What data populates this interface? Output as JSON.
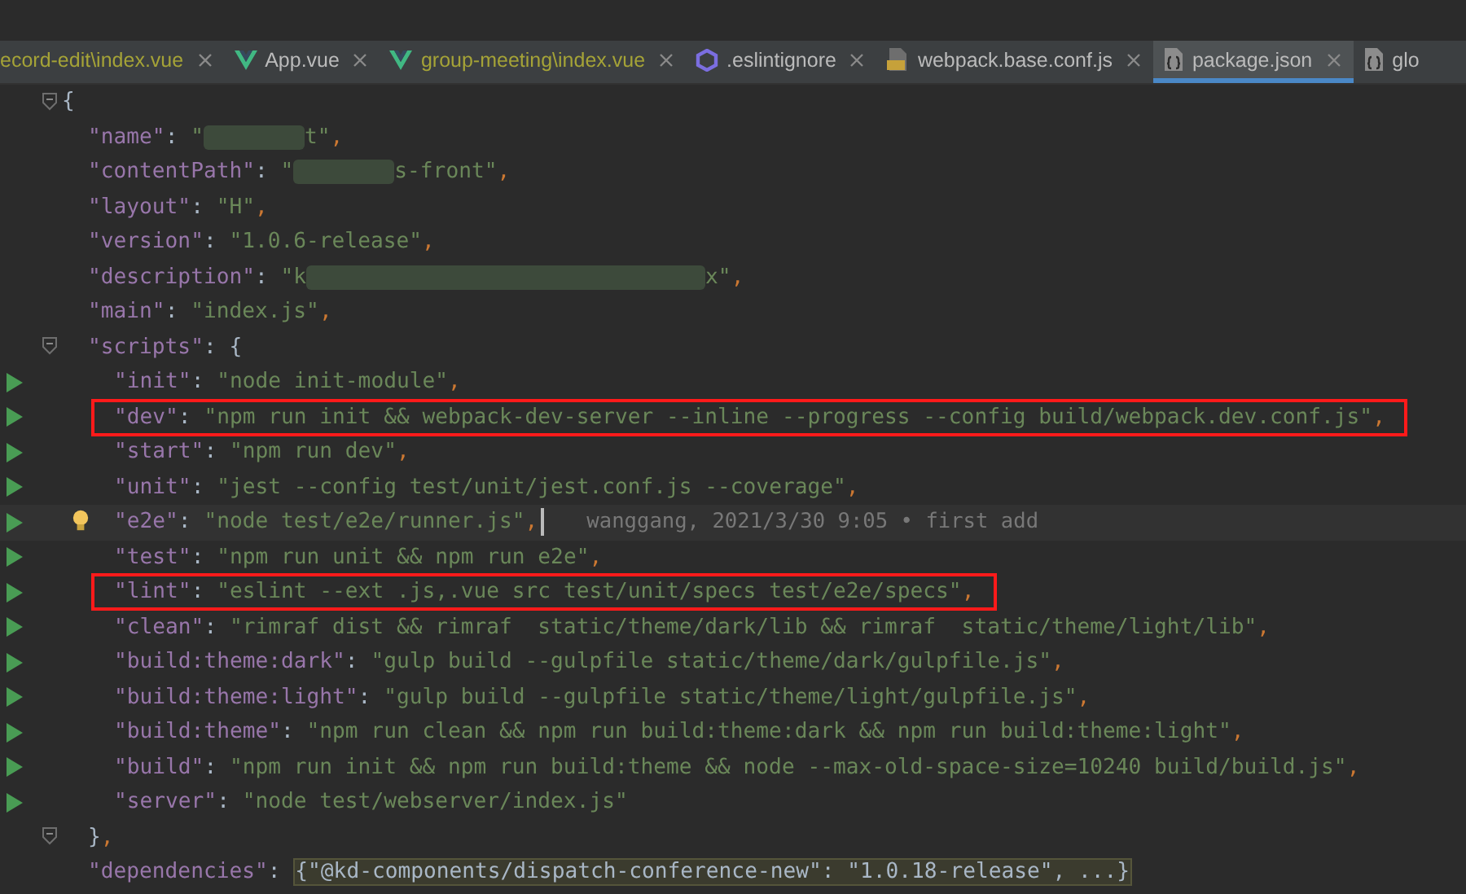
{
  "tabs": [
    {
      "label": "ecord-edit\\index.vue",
      "kind": "plain",
      "modified": true,
      "selected": false
    },
    {
      "label": "App.vue",
      "kind": "vue",
      "modified": false,
      "selected": false
    },
    {
      "label": "group-meeting\\index.vue",
      "kind": "vue",
      "modified": true,
      "selected": false
    },
    {
      "label": ".eslintignore",
      "kind": "eslint",
      "modified": false,
      "selected": false
    },
    {
      "label": "webpack.base.conf.js",
      "kind": "js",
      "modified": false,
      "selected": false
    },
    {
      "label": "package.json",
      "kind": "json",
      "modified": false,
      "selected": true
    },
    {
      "label": "glo",
      "kind": "json",
      "modified": false,
      "selected": false
    }
  ],
  "lines": [
    {
      "fold": true,
      "tokens": [
        {
          "kind": "punct",
          "s": "{"
        }
      ],
      "children": [
        {
          "tokens": [
            {
              "kind": "key",
              "s": "\"name\""
            },
            {
              "kind": "punct",
              "s": ": "
            },
            {
              "kind": "str",
              "s": "\""
            },
            {
              "kind": "redacted"
            },
            {
              "kind": "str",
              "s": "t\""
            },
            {
              "kind": "comma",
              "s": ","
            }
          ]
        },
        {
          "tokens": [
            {
              "kind": "key",
              "s": "\"contentPath\""
            },
            {
              "kind": "punct",
              "s": ": "
            },
            {
              "kind": "str",
              "s": "\""
            },
            {
              "kind": "redacted"
            },
            {
              "kind": "str",
              "s": "s-front\""
            },
            {
              "kind": "comma",
              "s": ","
            }
          ]
        },
        {
          "tokens": [
            {
              "kind": "key",
              "s": "\"layout\""
            },
            {
              "kind": "punct",
              "s": ": "
            },
            {
              "kind": "str",
              "s": "\"H\""
            },
            {
              "kind": "comma",
              "s": ","
            }
          ]
        },
        {
          "tokens": [
            {
              "kind": "key",
              "s": "\"version\""
            },
            {
              "kind": "punct",
              "s": ": "
            },
            {
              "kind": "str",
              "s": "\"1.0.6-release\""
            },
            {
              "kind": "comma",
              "s": ","
            }
          ]
        },
        {
          "tokens": [
            {
              "kind": "key",
              "s": "\"description\""
            },
            {
              "kind": "punct",
              "s": ": "
            },
            {
              "kind": "str",
              "s": "\"k"
            },
            {
              "kind": "redactedlong"
            },
            {
              "kind": "str",
              "s": "x\""
            },
            {
              "kind": "comma",
              "s": ","
            }
          ]
        },
        {
          "tokens": [
            {
              "kind": "key",
              "s": "\"main\""
            },
            {
              "kind": "punct",
              "s": ": "
            },
            {
              "kind": "str",
              "s": "\"index.js\""
            },
            {
              "kind": "comma",
              "s": ","
            }
          ]
        },
        {
          "fold": true,
          "tokens": [
            {
              "kind": "key",
              "s": "\"scripts\""
            },
            {
              "kind": "punct",
              "s": ": {"
            }
          ],
          "children": [
            {
              "run": true,
              "tokens": [
                {
                  "kind": "key",
                  "s": "\"init\""
                },
                {
                  "kind": "punct",
                  "s": ": "
                },
                {
                  "kind": "str",
                  "s": "\"node init-module\""
                },
                {
                  "kind": "comma",
                  "s": ","
                }
              ]
            },
            {
              "run": true,
              "boxed": true,
              "tokens": [
                {
                  "kind": "key",
                  "s": "\"dev\""
                },
                {
                  "kind": "punct",
                  "s": ": "
                },
                {
                  "kind": "str",
                  "s": "\"npm run init && webpack-dev-server --inline --progress --config build/webpack.dev.conf.js\""
                },
                {
                  "kind": "comma",
                  "s": ","
                }
              ]
            },
            {
              "run": true,
              "tokens": [
                {
                  "kind": "key",
                  "s": "\"start\""
                },
                {
                  "kind": "punct",
                  "s": ": "
                },
                {
                  "kind": "str",
                  "s": "\"npm run dev\""
                },
                {
                  "kind": "comma",
                  "s": ","
                }
              ]
            },
            {
              "run": true,
              "tokens": [
                {
                  "kind": "key",
                  "s": "\"unit\""
                },
                {
                  "kind": "punct",
                  "s": ": "
                },
                {
                  "kind": "str",
                  "s": "\"jest --config test/unit/jest.conf.js --coverage\""
                },
                {
                  "kind": "comma",
                  "s": ","
                }
              ]
            },
            {
              "run": true,
              "current": true,
              "bulb": true,
              "blame": "wanggang, 2021/3/30 9:05 • first add",
              "tokens": [
                {
                  "kind": "key",
                  "s": "\"e2e\""
                },
                {
                  "kind": "punct",
                  "s": ": "
                },
                {
                  "kind": "str",
                  "s": "\"node test/e2e/runner.js\""
                },
                {
                  "kind": "comma",
                  "s": ","
                }
              ]
            },
            {
              "run": true,
              "tokens": [
                {
                  "kind": "key",
                  "s": "\"test\""
                },
                {
                  "kind": "punct",
                  "s": ": "
                },
                {
                  "kind": "str",
                  "s": "\"npm run unit && npm run e2e\""
                },
                {
                  "kind": "comma",
                  "s": ","
                }
              ]
            },
            {
              "run": true,
              "boxed": true,
              "tokens": [
                {
                  "kind": "key",
                  "s": "\"lint\""
                },
                {
                  "kind": "punct",
                  "s": ": "
                },
                {
                  "kind": "str",
                  "s": "\"eslint --ext .js,.vue src test/unit/specs test/e2e/specs\""
                },
                {
                  "kind": "comma",
                  "s": ","
                }
              ]
            },
            {
              "run": true,
              "tokens": [
                {
                  "kind": "key",
                  "s": "\"clean\""
                },
                {
                  "kind": "punct",
                  "s": ": "
                },
                {
                  "kind": "str",
                  "s": "\"rimraf dist && rimraf  static/theme/dark/lib && rimraf  static/theme/light/lib\""
                },
                {
                  "kind": "comma",
                  "s": ","
                }
              ]
            },
            {
              "run": true,
              "tokens": [
                {
                  "kind": "key",
                  "s": "\"build:theme:dark\""
                },
                {
                  "kind": "punct",
                  "s": ": "
                },
                {
                  "kind": "str",
                  "s": "\"gulp build --gulpfile static/theme/dark/gulpfile.js\""
                },
                {
                  "kind": "comma",
                  "s": ","
                }
              ]
            },
            {
              "run": true,
              "tokens": [
                {
                  "kind": "key",
                  "s": "\"build:theme:light\""
                },
                {
                  "kind": "punct",
                  "s": ": "
                },
                {
                  "kind": "str",
                  "s": "\"gulp build --gulpfile static/theme/light/gulpfile.js\""
                },
                {
                  "kind": "comma",
                  "s": ","
                }
              ]
            },
            {
              "run": true,
              "tokens": [
                {
                  "kind": "key",
                  "s": "\"build:theme\""
                },
                {
                  "kind": "punct",
                  "s": ": "
                },
                {
                  "kind": "str",
                  "s": "\"npm run clean && npm run build:theme:dark && npm run build:theme:light\""
                },
                {
                  "kind": "comma",
                  "s": ","
                }
              ]
            },
            {
              "run": true,
              "tokens": [
                {
                  "kind": "key",
                  "s": "\"build\""
                },
                {
                  "kind": "punct",
                  "s": ": "
                },
                {
                  "kind": "str",
                  "s": "\"npm run init && npm run build:theme && node --max-old-space-size=10240 build/build.js\""
                },
                {
                  "kind": "comma",
                  "s": ","
                }
              ]
            },
            {
              "run": true,
              "tokens": [
                {
                  "kind": "key",
                  "s": "\"server\""
                },
                {
                  "kind": "punct",
                  "s": ": "
                },
                {
                  "kind": "str",
                  "s": "\"node test/webserver/index.js\""
                }
              ]
            }
          ]
        },
        {
          "fold": true,
          "tokens": [
            {
              "kind": "punct",
              "s": "}"
            },
            {
              "kind": "comma",
              "s": ","
            }
          ]
        },
        {
          "tokens": [
            {
              "kind": "key",
              "s": "\"dependencies\""
            },
            {
              "kind": "punct",
              "s": ": "
            },
            {
              "kind": "folded",
              "s": "{\"@kd-components/dispatch-conference-new\": \"1.0.18-release\", ...}"
            }
          ]
        }
      ]
    }
  ]
}
